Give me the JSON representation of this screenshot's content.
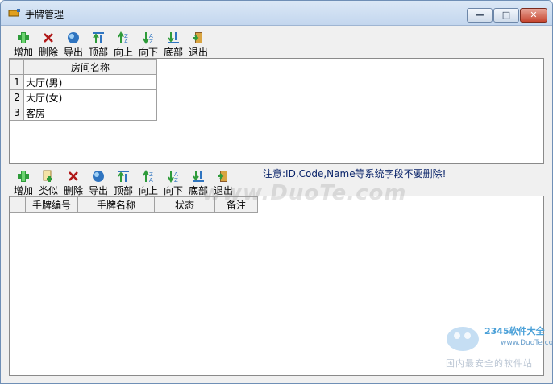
{
  "window": {
    "title": "手牌管理",
    "controls": {
      "min": "—",
      "max": "□",
      "close": "✕"
    }
  },
  "room_toolbar": {
    "items": [
      {
        "label": "增加",
        "icon": "add-icon"
      },
      {
        "label": "删除",
        "icon": "delete-icon"
      },
      {
        "label": "导出",
        "icon": "export-icon"
      },
      {
        "label": "顶部",
        "icon": "move-top-icon"
      },
      {
        "label": "向上",
        "icon": "move-up-icon"
      },
      {
        "label": "向下",
        "icon": "move-down-icon"
      },
      {
        "label": "底部",
        "icon": "move-bottom-icon"
      },
      {
        "label": "退出",
        "icon": "exit-icon"
      }
    ]
  },
  "room_table": {
    "header": "房间名称",
    "rows": [
      {
        "num": "1",
        "name": "大厅(男)"
      },
      {
        "num": "2",
        "name": "大厅(女)"
      },
      {
        "num": "3",
        "name": "客房"
      }
    ]
  },
  "card_toolbar": {
    "items": [
      {
        "label": "增加",
        "icon": "add-icon"
      },
      {
        "label": "类似",
        "icon": "similar-icon"
      },
      {
        "label": "删除",
        "icon": "delete-icon"
      },
      {
        "label": "导出",
        "icon": "export-icon"
      },
      {
        "label": "顶部",
        "icon": "move-top-icon"
      },
      {
        "label": "向上",
        "icon": "move-up-icon"
      },
      {
        "label": "向下",
        "icon": "move-down-icon"
      },
      {
        "label": "底部",
        "icon": "move-bottom-icon"
      },
      {
        "label": "退出",
        "icon": "exit-icon"
      }
    ]
  },
  "note": "注意:ID,Code,Name等系统字段不要删除!",
  "card_table": {
    "columns": [
      "手牌编号",
      "手牌名称",
      "状态",
      "备注"
    ]
  },
  "watermark": {
    "text": "www.DuoTe.com",
    "logo_brand": "2345软件大全",
    "logo_url": "www.DuoTe.com",
    "logo_slogan": "国内最安全的软件站"
  },
  "colors": {
    "title_bar": "#c3d6ee",
    "accent": "#0a246a"
  }
}
